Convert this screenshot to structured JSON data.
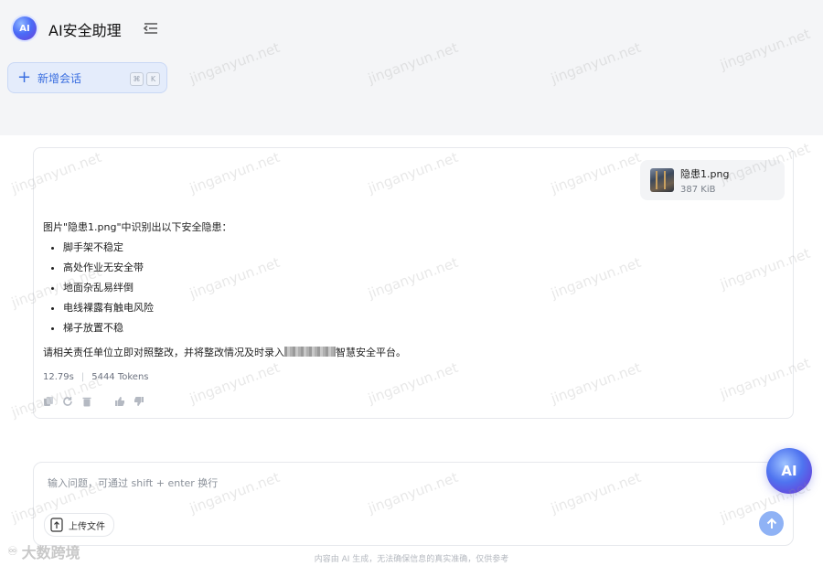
{
  "header": {
    "logo_text": "AI",
    "app_title": "AI安全助理"
  },
  "sidebar": {
    "new_chat_label": "新增会话",
    "shortcut_keys": [
      "⌘",
      "K"
    ]
  },
  "conversation": {
    "attachment": {
      "file_name": "隐患1.png",
      "file_size": "387 KiB"
    },
    "answer": {
      "intro": "图片\"隐患1.png\"中识别出以下安全隐患：",
      "hazards": [
        "脚手架不稳定",
        "高处作业无安全带",
        "地面杂乱易绊倒",
        "电线裸露有触电风险",
        "梯子放置不稳"
      ],
      "closing_before": "请相关责任单位立即对照整改，并将整改情况及时录入",
      "closing_after": "智慧安全平台。",
      "elapsed": "12.79s",
      "tokens": "5444 Tokens"
    }
  },
  "composer": {
    "placeholder": "输入问题，可通过 shift + enter 换行",
    "upload_label": "上传文件"
  },
  "footer": {
    "disclaimer": "内容由 AI 生成，无法确保信息的真实准确，仅供参考"
  },
  "floating_button": {
    "label": "AI"
  },
  "watermark": {
    "text": "jinganyun.net",
    "brand_logo_text": "大数跨境"
  },
  "colors": {
    "accent": "#3b6fe0",
    "send_button": "#8fb2f5",
    "top_background": "#f4f5f7"
  }
}
